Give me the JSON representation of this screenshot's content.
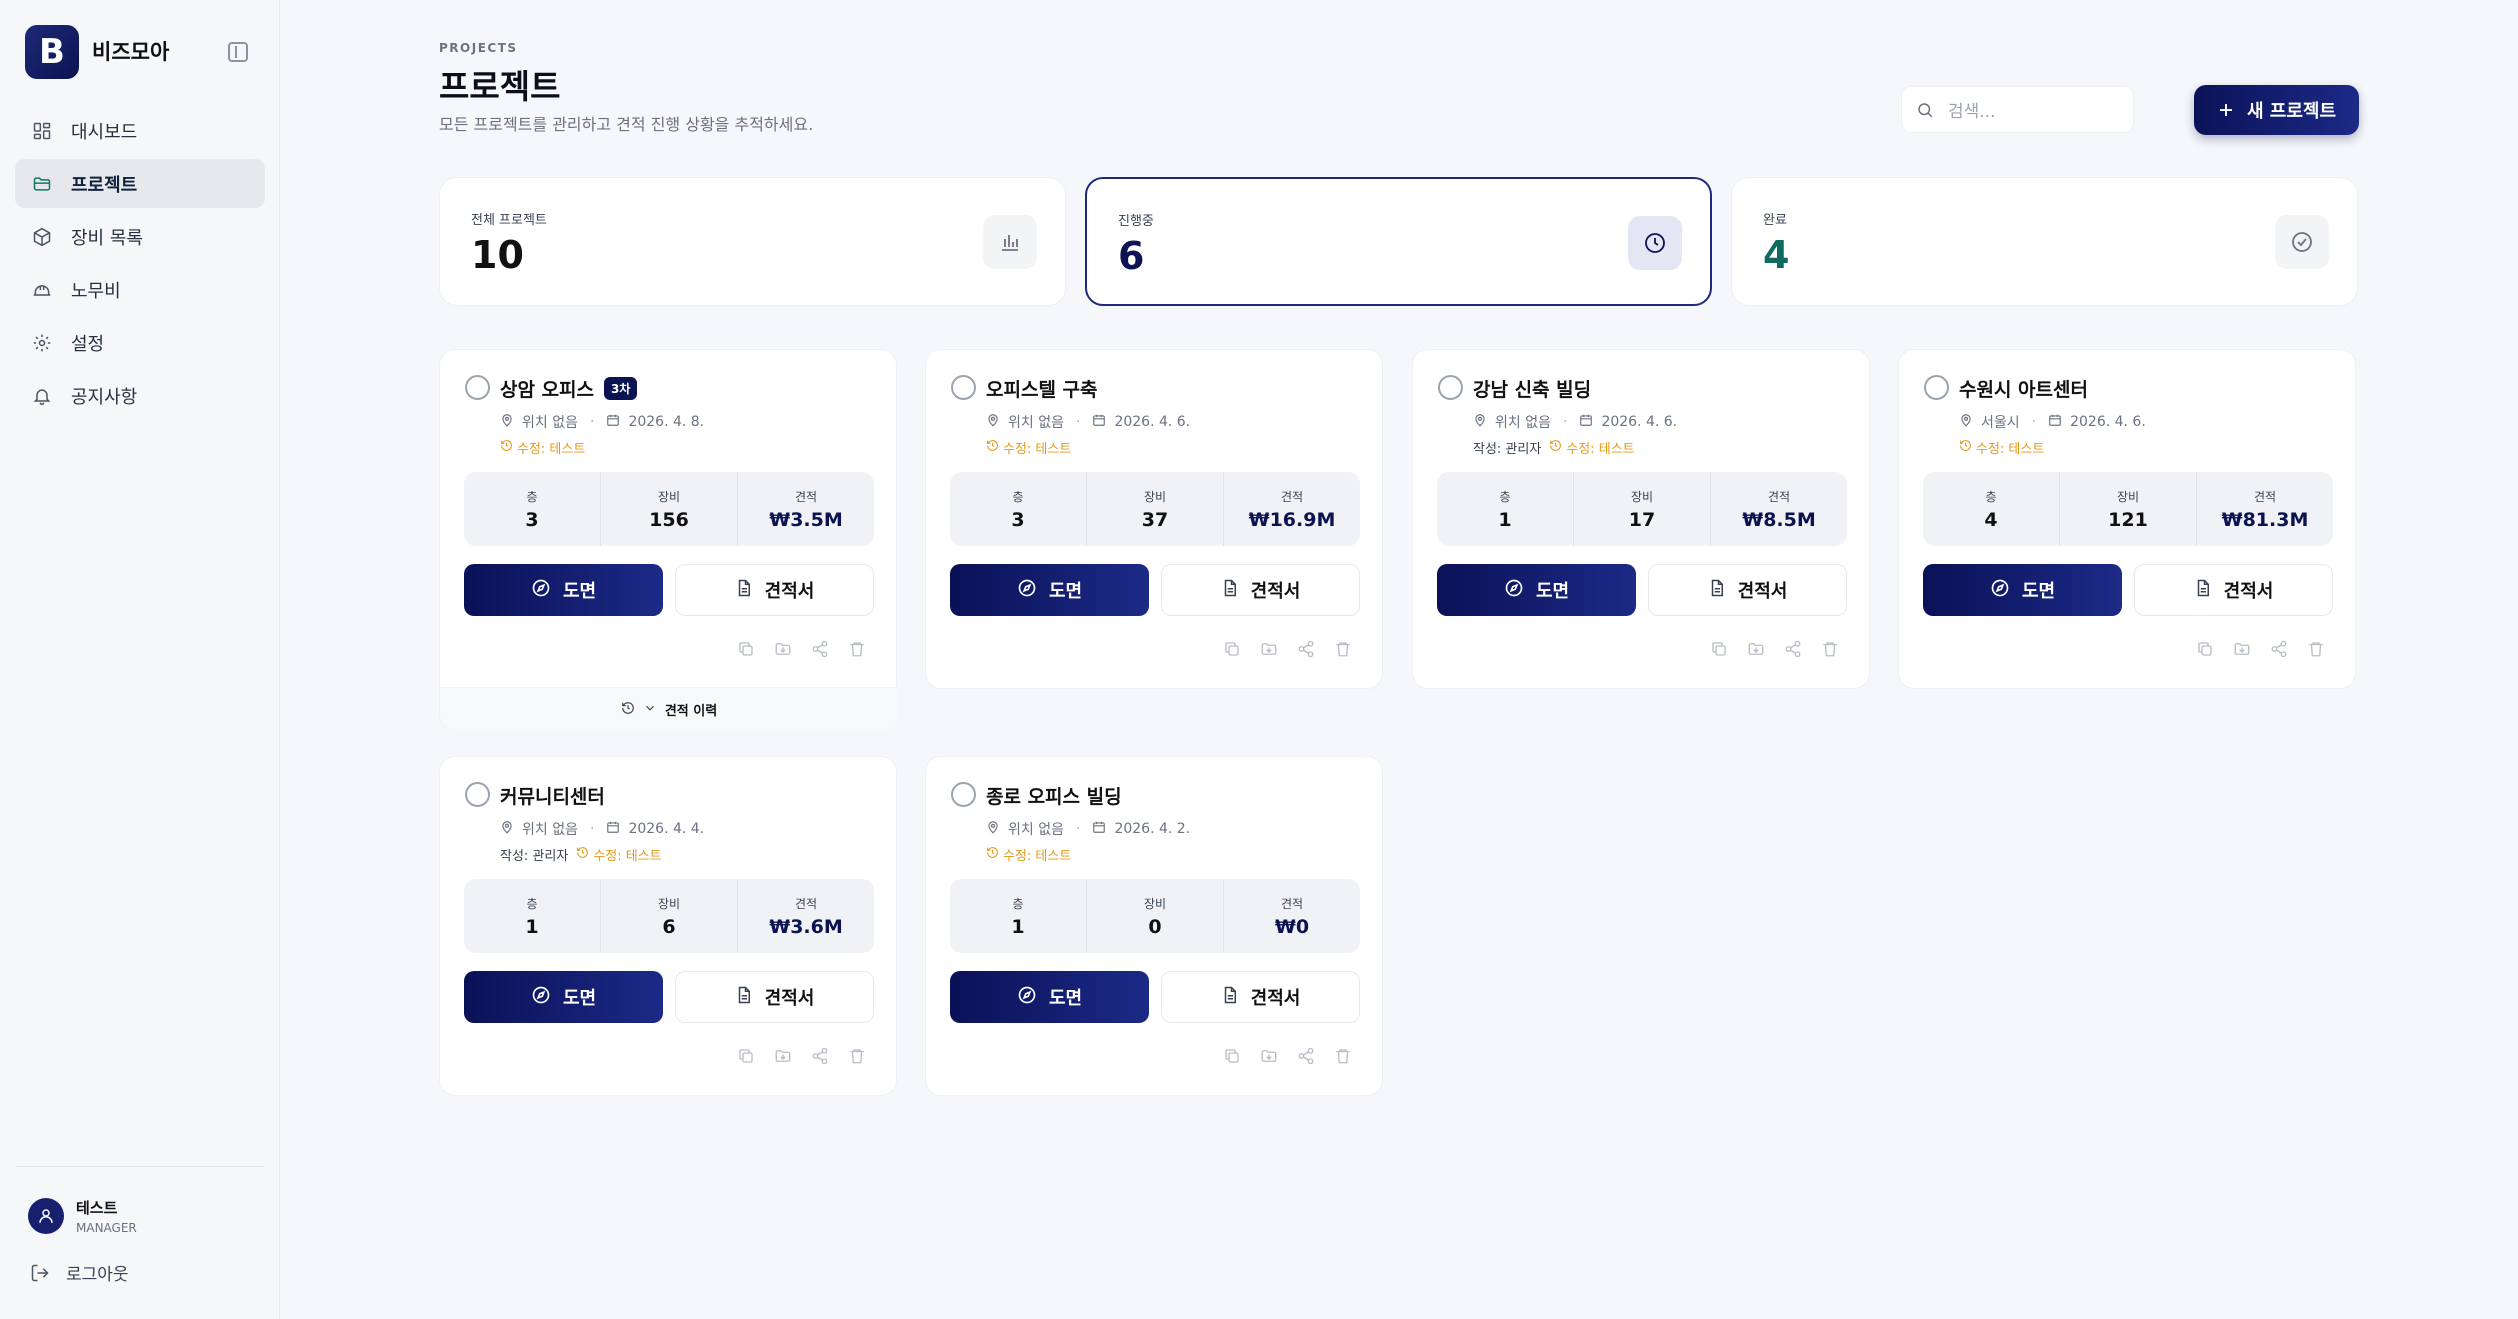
{
  "app": {
    "name": "비즈모아",
    "logo_letter": "B"
  },
  "sidebar": {
    "items": [
      {
        "label": "대시보드",
        "icon": "dashboard-icon"
      },
      {
        "label": "프로젝트",
        "icon": "folder-icon"
      },
      {
        "label": "장비 목록",
        "icon": "box-icon"
      },
      {
        "label": "노무비",
        "icon": "hardhat-icon"
      },
      {
        "label": "설정",
        "icon": "gear-icon"
      },
      {
        "label": "공지사항",
        "icon": "bell-icon"
      }
    ]
  },
  "user": {
    "name": "테스트",
    "role": "MANAGER"
  },
  "logout_label": "로그아웃",
  "header": {
    "eyebrow": "PROJECTS",
    "title": "프로젝트",
    "subtitle": "모든 프로젝트를 관리하고 견적 진행 상황을 추적하세요.",
    "search_placeholder": "검색...",
    "new_button": "새 프로젝트"
  },
  "stats": [
    {
      "label": "전체 프로젝트",
      "value": "10",
      "color": "#111111"
    },
    {
      "label": "진행중",
      "value": "6",
      "color": "#0b1352"
    },
    {
      "label": "완료",
      "value": "4",
      "color": "#0f6b5e"
    }
  ],
  "labels": {
    "floors": "층",
    "equipment": "장비",
    "estimate": "견적",
    "drawing_button": "도면",
    "estimate_button": "견적서",
    "history": "견적 이력"
  },
  "projects": [
    {
      "title": "상암 오피스",
      "badge": "3차",
      "location": "위치 없음",
      "date": "2026. 4. 8.",
      "author": "",
      "edited": "수정: 테스트",
      "floors": "3",
      "equipment": "156",
      "cost": "₩3.5M"
    },
    {
      "title": "오피스텔 구축",
      "badge": "",
      "location": "위치 없음",
      "date": "2026. 4. 6.",
      "author": "",
      "edited": "수정: 테스트",
      "floors": "3",
      "equipment": "37",
      "cost": "₩16.9M"
    },
    {
      "title": "강남 신축 빌딩",
      "badge": "",
      "location": "위치 없음",
      "date": "2026. 4. 6.",
      "author": "작성: 관리자",
      "edited": "수정: 테스트",
      "floors": "1",
      "equipment": "17",
      "cost": "₩8.5M"
    },
    {
      "title": "수원시 아트센터",
      "badge": "",
      "location": "서울시",
      "date": "2026. 4. 6.",
      "author": "",
      "edited": "수정: 테스트",
      "floors": "4",
      "equipment": "121",
      "cost": "₩81.3M"
    },
    {
      "title": "커뮤니티센터",
      "badge": "",
      "location": "위치 없음",
      "date": "2026. 4. 4.",
      "author": "작성: 관리자",
      "edited": "수정: 테스트",
      "floors": "1",
      "equipment": "6",
      "cost": "₩3.6M"
    },
    {
      "title": "종로 오피스 빌딩",
      "badge": "",
      "location": "위치 없음",
      "date": "2026. 4. 2.",
      "author": "",
      "edited": "수정: 테스트",
      "floors": "1",
      "equipment": "0",
      "cost": "₩0"
    }
  ]
}
